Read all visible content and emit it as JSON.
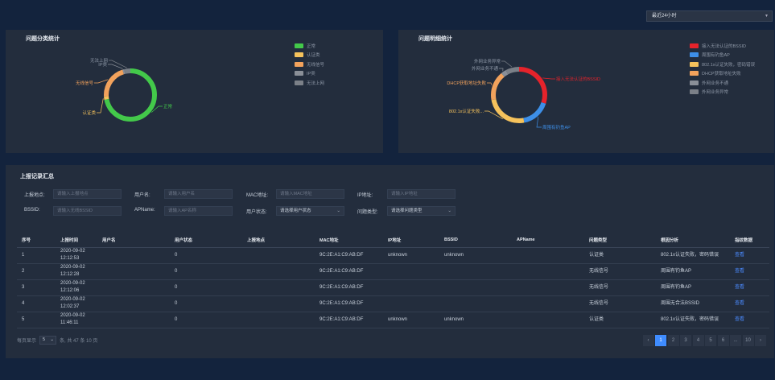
{
  "time_range": {
    "value": "最近24小时"
  },
  "problem_category": {
    "title": "问题分类统计",
    "legend": [
      {
        "label": "正常",
        "color": "#43c94a"
      },
      {
        "label": "认证类",
        "color": "#f5c25c"
      },
      {
        "label": "无线信号",
        "color": "#f2a25c"
      },
      {
        "label": "IP类",
        "color": "#8a8f98"
      },
      {
        "label": "无法上网",
        "color": "#7b8088"
      }
    ],
    "chart_data": {
      "type": "pie",
      "labels": [
        "正常",
        "认证类",
        "无线信号",
        "IP类",
        "无法上网"
      ],
      "values": [
        72,
        2,
        21,
        1,
        4
      ],
      "colors": [
        "#43c94a",
        "#f5c25c",
        "#f2a25c",
        "#8a8f98",
        "#7b8088"
      ],
      "title": "问题分类统计"
    },
    "callouts": [
      "正常",
      "认证类",
      "无线信号",
      "IP类",
      "无法上网"
    ]
  },
  "problem_detail": {
    "title": "问题明细统计",
    "legend": [
      {
        "label": "接入无法认证的BSSID",
        "color": "#e5232b"
      },
      {
        "label": "周围有钓鱼AP",
        "color": "#3d8fe8"
      },
      {
        "label": "802.1x认证失败，密码错误",
        "color": "#f5c25c"
      },
      {
        "label": "DHCP获取地址失败",
        "color": "#f2a25c"
      },
      {
        "label": "外网业务不通",
        "color": "#8a8f98"
      },
      {
        "label": "外网业务异常",
        "color": "#7b8088"
      }
    ],
    "chart_data": {
      "type": "pie",
      "labels": [
        "接入无法认证的BSSID",
        "周围有钓鱼AP",
        "802.1x认证失败，密码错误",
        "DHCP获取地址失败",
        "外网业务不通",
        "外网业务异常"
      ],
      "values": [
        30,
        17,
        25,
        17,
        3,
        8
      ],
      "colors": [
        "#e5232b",
        "#3d8fe8",
        "#f5c25c",
        "#f2a25c",
        "#8a8f98",
        "#7b8088"
      ],
      "title": "问题明细统计"
    },
    "callouts": [
      "接入无法认证的BSSID",
      "周围有钓鱼AP",
      "802.1x认证失败...",
      "DHCP获取地址失败",
      "外网业务不通",
      "外网业务异常"
    ]
  },
  "records": {
    "title": "上报记录汇总",
    "filters": {
      "location_label": "上报地点:",
      "location_placeholder": "请输入上报地点",
      "user_label": "用户名:",
      "user_placeholder": "请输入用户名",
      "mac_label": "MAC地址:",
      "mac_placeholder": "请输入MAC地址",
      "ip_label": "IP地址:",
      "ip_placeholder": "请输入IP地址",
      "bssid_label": "BSSID:",
      "bssid_placeholder": "请输入无线BSSID",
      "apname_label": "APName:",
      "apname_placeholder": "请输入AP名称",
      "status_label": "用户状态:",
      "status_value": "请选择用户状态",
      "type_label": "问题类型:",
      "type_value": "请选择问题类型"
    },
    "columns": [
      "序号",
      "上报时间",
      "用户名",
      "用户状态",
      "上报地点",
      "MAC地址",
      "IP地址",
      "BSSID",
      "APName",
      "问题类型",
      "根因分析",
      "指纹数据"
    ],
    "rows": [
      [
        "1",
        "2020-09-02 12:12:53",
        "",
        "0",
        "",
        "9C:2E:A1:C9:AB:DF",
        "unknown",
        "unknown",
        "",
        "认证类",
        "802.1x认证失败，密码错误",
        "查看"
      ],
      [
        "2",
        "2020-09-02 12:12:28",
        "",
        "0",
        "",
        "9C:2E:A1:C9:AB:DF",
        "",
        "",
        "",
        "无线信号",
        "周围有钓鱼AP",
        "查看"
      ],
      [
        "3",
        "2020-09-02 12:12:06",
        "",
        "0",
        "",
        "9C:2E:A1:C9:AB:DF",
        "",
        "",
        "",
        "无线信号",
        "周围有钓鱼AP",
        "查看"
      ],
      [
        "4",
        "2020-09-02 12:02:37",
        "",
        "0",
        "",
        "9C:2E:A1:C9:AB:DF",
        "",
        "",
        "",
        "无线信号",
        "周围无合法BSSID",
        "查看"
      ],
      [
        "5",
        "2020-09-02 11:46:11",
        "",
        "0",
        "",
        "9C:2E:A1:C9:AB:DF",
        "unknown",
        "unknown",
        "",
        "认证类",
        "802.1x认证失败，密码错误",
        "查看"
      ]
    ],
    "pager": {
      "prefix": "每页显示",
      "page_size": "5",
      "summary": "条, 共 47 条 10 页",
      "prev": "‹",
      "next": "›",
      "pages": [
        "1",
        "2",
        "3",
        "4",
        "5",
        "6",
        "...",
        "10"
      ],
      "current": "1"
    }
  }
}
